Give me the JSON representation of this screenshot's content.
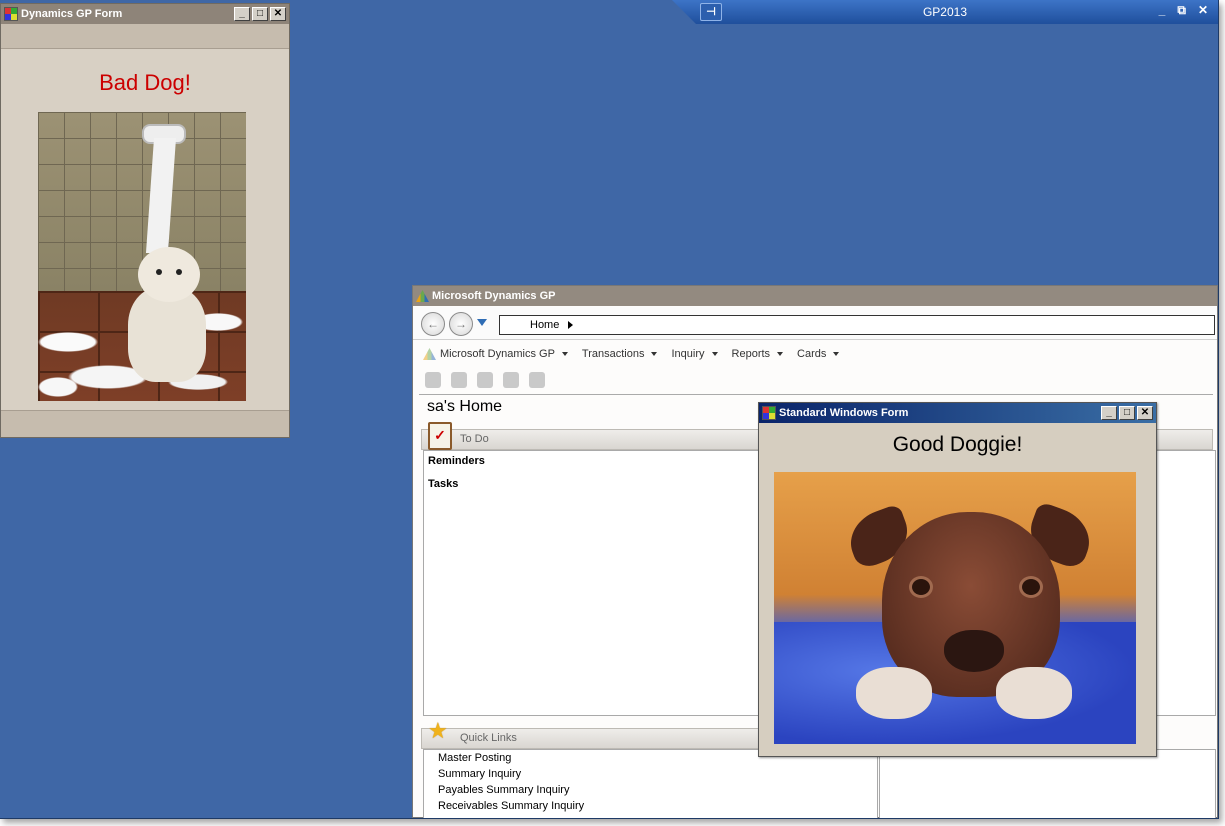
{
  "remote_desktop": {
    "title": "GP2013",
    "pin": "⊣",
    "controls": [
      "_",
      "⧉",
      "✕"
    ]
  },
  "gp_form": {
    "title": "Dynamics GP Form",
    "heading": "Bad Dog!"
  },
  "std_form": {
    "title": "Standard Windows Form",
    "heading": "Good Doggie!"
  },
  "title_buttons": {
    "minimize": "_",
    "maximize": "□",
    "close": "✕"
  },
  "gp_main": {
    "title": "Microsoft Dynamics GP",
    "address": "Home",
    "menus": [
      {
        "label": "Microsoft Dynamics GP"
      },
      {
        "label": "Transactions"
      },
      {
        "label": "Inquiry"
      },
      {
        "label": "Reports"
      },
      {
        "label": "Cards"
      }
    ],
    "home_title": "sa's Home",
    "todo": {
      "header": "To Do",
      "reminders": "Reminders",
      "tasks": "Tasks"
    },
    "quick_links": {
      "header": "Quick Links",
      "items": [
        "Master Posting",
        "Summary Inquiry",
        "Payables Summary Inquiry",
        "Receivables Summary Inquiry"
      ]
    }
  }
}
